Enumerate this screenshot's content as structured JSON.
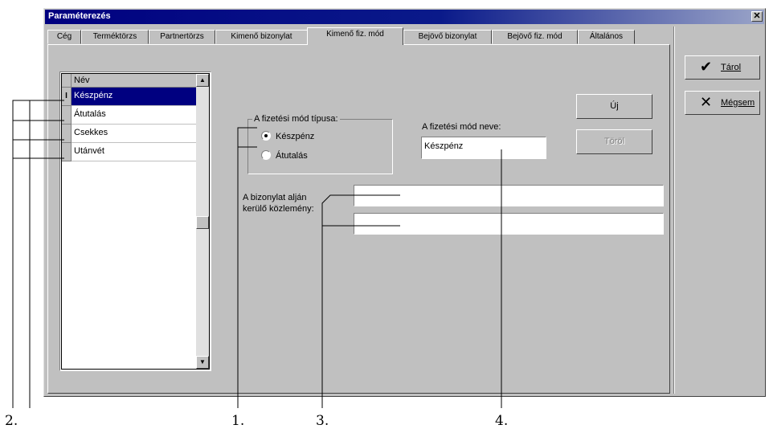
{
  "window": {
    "title": "Paraméterezés",
    "close_glyph": "✕"
  },
  "tabs": [
    {
      "label": "Cég"
    },
    {
      "label": "Terméktörzs"
    },
    {
      "label": "Partnertörzs"
    },
    {
      "label": "Kimenő bizonylat"
    },
    {
      "label": "Kimenő fiz. mód"
    },
    {
      "label": "Bejövő bizonylat"
    },
    {
      "label": "Bejövő fiz. mód"
    },
    {
      "label": "Általános"
    }
  ],
  "active_tab": "Kimenő fiz. mód",
  "grid": {
    "header": "Név",
    "rows": [
      {
        "label": "Készpénz",
        "indicator": "I",
        "selected": true
      },
      {
        "label": "Átutalás",
        "indicator": "",
        "selected": false
      },
      {
        "label": "Csekkes",
        "indicator": "",
        "selected": false
      },
      {
        "label": "Utánvét",
        "indicator": "",
        "selected": false
      }
    ],
    "scroll_up_glyph": "▲",
    "scroll_down_glyph": "▼"
  },
  "payment_type": {
    "legend": "A fizetési mód típusa:",
    "options": [
      {
        "label": "Készpénz",
        "checked": true
      },
      {
        "label": "Átutalás",
        "checked": false
      }
    ]
  },
  "name_field": {
    "label": "A fizetési mód neve:",
    "value": "Készpénz"
  },
  "buttons": {
    "new_label": "Új",
    "delete_label": "Töröl",
    "save_label": "Tárol",
    "cancel_label": "Mégsem"
  },
  "icons": {
    "save_icon": "check-icon",
    "cancel_icon": "x-icon",
    "save_glyph": "✔",
    "cancel_glyph": "✕"
  },
  "footer_note": {
    "label_line1": "A bizonylat alján",
    "label_line2": "kerülő közlemény:",
    "line1_value": "",
    "line2_value": ""
  },
  "callouts": [
    "1.",
    "2.",
    "3.",
    "4."
  ],
  "colors": {
    "title_bar": "#000080",
    "selection": "#000080",
    "face": "#c0c0c0"
  }
}
